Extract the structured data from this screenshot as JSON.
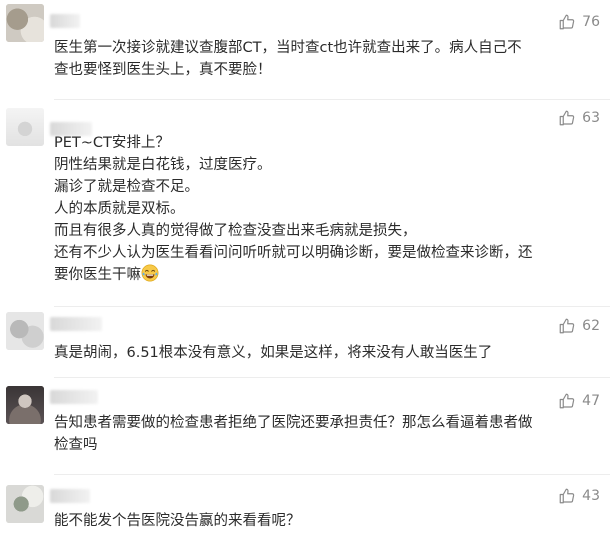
{
  "comments": [
    {
      "likes": "76",
      "lines": [
        "医生第一次接诊就建议查腹部CT，当时查ct也许就查出来了。病人自己不",
        "查也要怪到医生头上，真不要脸！"
      ]
    },
    {
      "likes": "63",
      "lines": [
        "PET~CT安排上？",
        "阴性结果就是白花钱，过度医疗。",
        "漏诊了就是检查不足。",
        "人的本质就是双标。",
        "而且有很多人真的觉得做了检查没查出来毛病就是损失，",
        "还有不少人认为医生看看问问听听就可以明确诊断，要是做检查来诊断，还",
        "要你医生干嘛"
      ],
      "emoji": "laughing-crying-emoji"
    },
    {
      "likes": "62",
      "lines": [
        "真是胡闹，6.51根本没有意义，如果是这样，将来没有人敢当医生了"
      ]
    },
    {
      "likes": "47",
      "lines": [
        "告知患者需要做的检查患者拒绝了医院还要承担责任？那怎么看逼着患者做",
        "检查吗"
      ]
    },
    {
      "likes": "43",
      "lines": [
        "能不能发个告医院没告赢的来看看呢？"
      ]
    }
  ],
  "icons": {
    "like": "thumbs-up-icon"
  },
  "colors": {
    "text": "#2b2b2b",
    "like_count": "#8a8a8a",
    "divider": "#ededed"
  }
}
